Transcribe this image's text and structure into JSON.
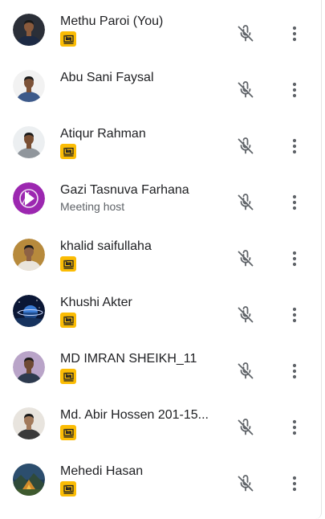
{
  "participants": [
    {
      "name": "Methu Paroi (You)",
      "sub": "",
      "presenting": true,
      "avatar": "avatar-photo",
      "avatar_bg": "#2b2f38",
      "skin": "#8a5a3c",
      "shirt": "#1d2a44"
    },
    {
      "name": "Abu Sani Faysal",
      "sub": "",
      "presenting": false,
      "avatar": "avatar-photo",
      "avatar_bg": "#f2f2f2",
      "skin": "#7c5238",
      "shirt": "#3d5a8a"
    },
    {
      "name": "Atiqur Rahman",
      "sub": "",
      "presenting": true,
      "avatar": "avatar-photo",
      "avatar_bg": "#eceff1",
      "skin": "#7a4f33",
      "shirt": "#90969c"
    },
    {
      "name": "Gazi Tasnuva Farhana",
      "sub": "Meeting host",
      "presenting": false,
      "avatar": "avatar-logo",
      "avatar_bg": "#9c27b0",
      "skin": "",
      "shirt": ""
    },
    {
      "name": "khalid saifullaha",
      "sub": "",
      "presenting": true,
      "avatar": "avatar-photo",
      "avatar_bg": "#b78a3c",
      "skin": "#8e6244",
      "shirt": "#e9e4dc"
    },
    {
      "name": "Khushi Akter",
      "sub": "",
      "presenting": true,
      "avatar": "avatar-space",
      "avatar_bg": "#0b1736",
      "skin": "",
      "shirt": ""
    },
    {
      "name": "MD IMRAN SHEIKH_11",
      "sub": "",
      "presenting": true,
      "avatar": "avatar-photo",
      "avatar_bg": "#b9a4c8",
      "skin": "#6e4a33",
      "shirt": "#2d3a4e"
    },
    {
      "name": "Md. Abir Hossen 201-15...",
      "sub": "",
      "presenting": true,
      "avatar": "avatar-photo",
      "avatar_bg": "#e8e4de",
      "skin": "#a27a5c",
      "shirt": "#3a3a3a"
    },
    {
      "name": "Mehedi Hasan",
      "sub": "",
      "presenting": true,
      "avatar": "avatar-landscape",
      "avatar_bg": "#2f4a3a",
      "skin": "",
      "shirt": ""
    }
  ],
  "icons": {
    "mic": "mic-off-icon",
    "more": "more-vert-icon",
    "present": "presenting-icon"
  },
  "colors": {
    "present_badge": "#fbbc04",
    "icon_gray": "#5f6368",
    "text": "#202124"
  }
}
